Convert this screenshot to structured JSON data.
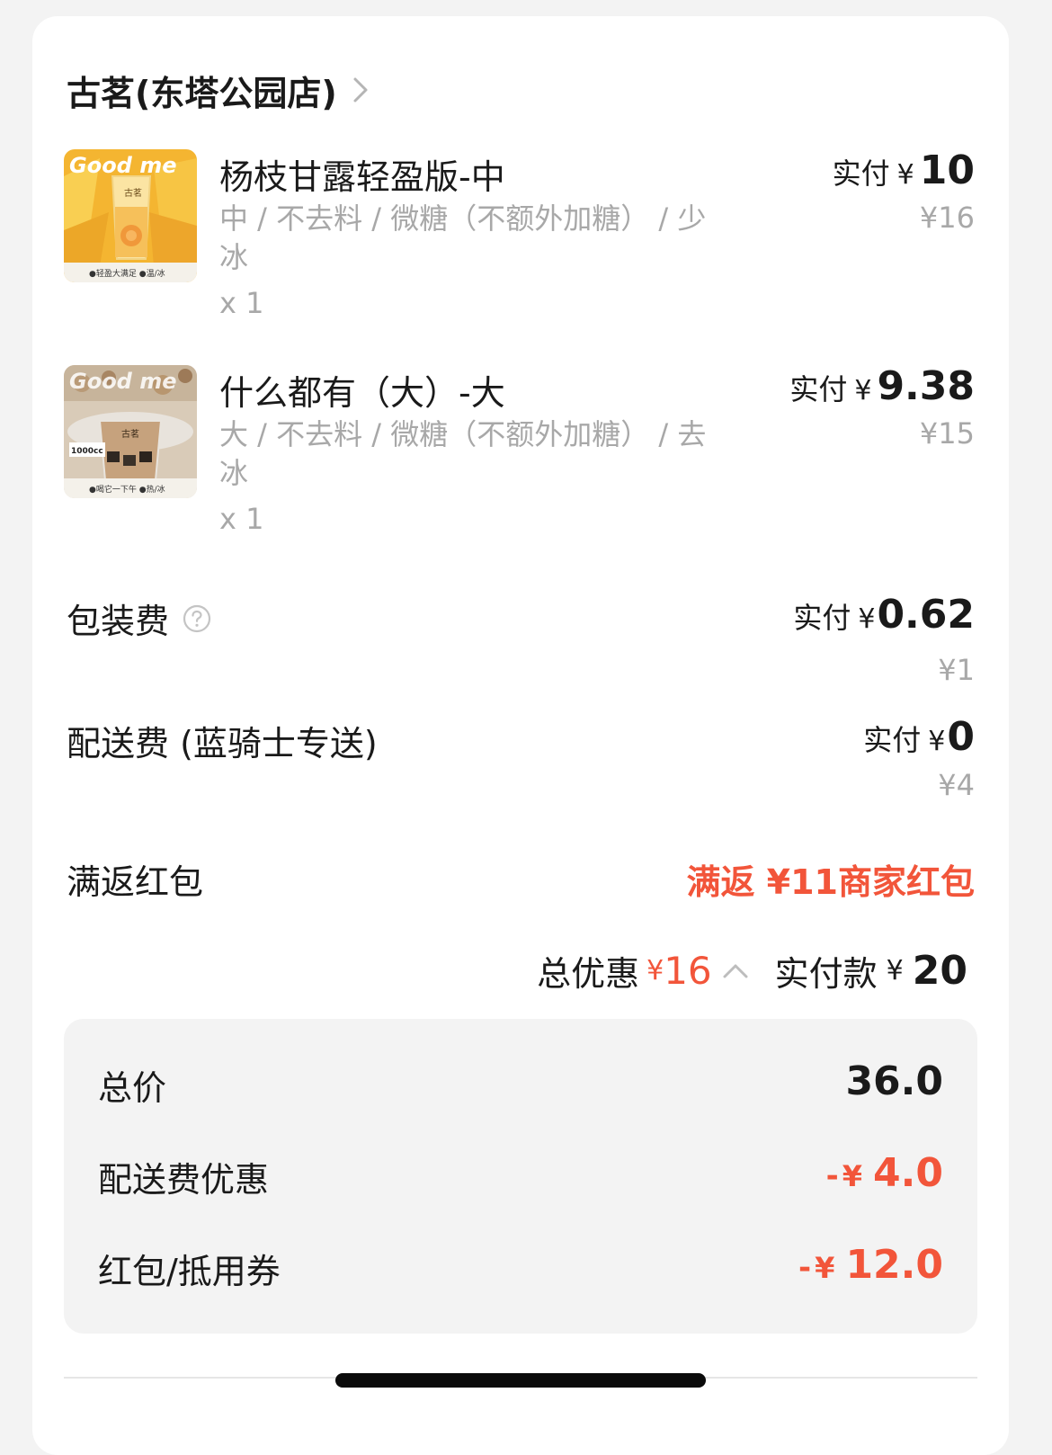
{
  "store": {
    "name": "古茗(东塔公园店)",
    "chevron_icon": "chevron-right-icon"
  },
  "items": [
    {
      "name": "杨枝甘露轻盈版-中",
      "spec": "中 / 不去料 / 微糖（不额外加糖） / 少冰",
      "qty": "x 1",
      "pay_label": "实付",
      "pay_yen": "¥",
      "pay_amount": "10",
      "original": "¥16",
      "thumb": {
        "brand": "Good me",
        "cup_text": "古茗",
        "footer": "●轻盈大满足  ●温/冰"
      }
    },
    {
      "name": "什么都有（大）-大",
      "spec": "大 / 不去料 / 微糖（不额外加糖） / 去冰",
      "qty": "x 1",
      "pay_label": "实付",
      "pay_yen": "¥",
      "pay_amount": "9.38",
      "original": "¥15",
      "thumb": {
        "brand": "Good me",
        "cup_text": "古茗",
        "badge": "1000cc",
        "footer": "●喝它一下午  ●热/冰"
      }
    }
  ],
  "packaging": {
    "label": "包装费",
    "help_icon": "help-circle-icon",
    "pay_label": "实付",
    "pay_yen": "¥",
    "pay_amount": "0.62",
    "original": "¥1"
  },
  "delivery": {
    "label": "配送费 (蓝骑士专送)",
    "pay_label": "实付",
    "pay_yen": "¥",
    "pay_amount": "0",
    "original": "¥4"
  },
  "rebate": {
    "label": "满返红包",
    "value": "满返 ¥11商家红包"
  },
  "summary": {
    "discount_label": "总优惠",
    "discount_yen": "¥",
    "discount_amount": "16",
    "expand_icon": "chevron-up-icon",
    "total_label": "实付款",
    "total_yen": "¥",
    "total_amount": "20"
  },
  "breakdown": [
    {
      "label": "总价",
      "value": "36.0",
      "negative": false
    },
    {
      "label": "配送费优惠",
      "minus": "-",
      "yen": "¥",
      "value": "4.0",
      "negative": true
    },
    {
      "label": "红包/抵用券",
      "minus": "-",
      "yen": "¥",
      "value": "12.0",
      "negative": true
    }
  ],
  "colors": {
    "accent_red": "#f2553a",
    "muted": "#a8a8a8",
    "text": "#1a1a1a"
  }
}
